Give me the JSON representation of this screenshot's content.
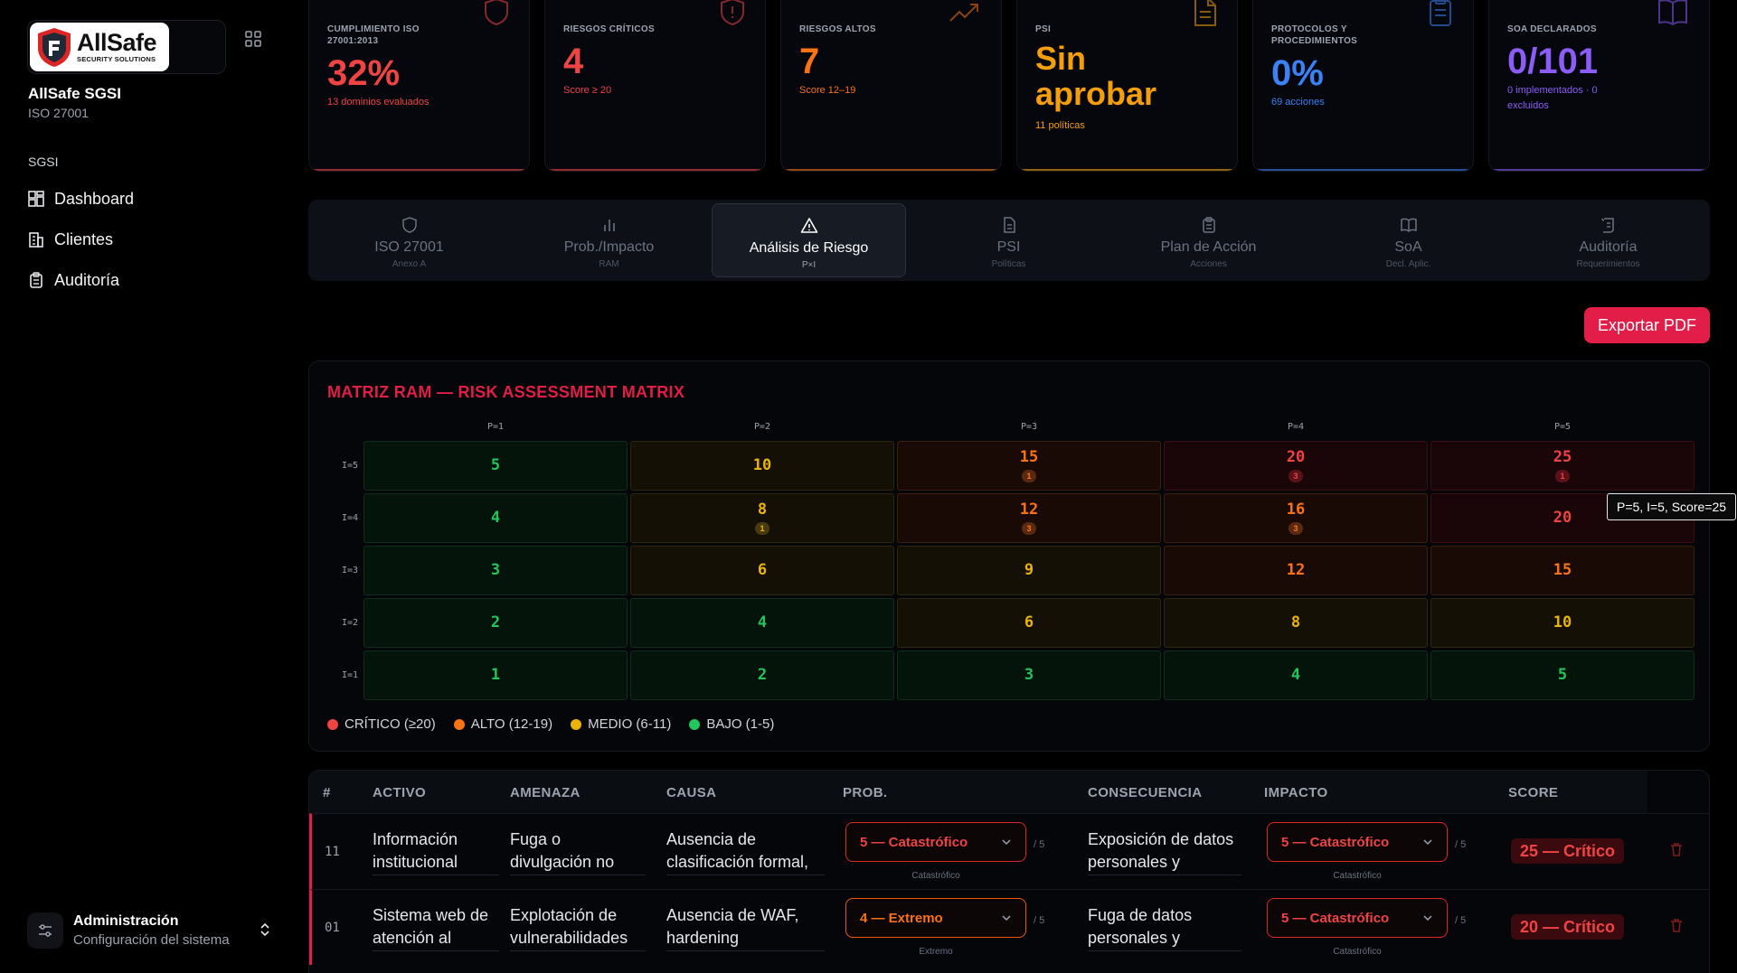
{
  "sidebar": {
    "logo": {
      "brand": "AllSafe",
      "tagline": "SECURITY SOLUTIONS"
    },
    "app_name": "AllSafe SGSI",
    "app_sub": "ISO 27001",
    "section_label": "SGSI",
    "items": [
      {
        "label": "Dashboard",
        "icon": "dashboard-icon"
      },
      {
        "label": "Clientes",
        "icon": "building-icon"
      },
      {
        "label": "Auditoría",
        "icon": "clipboard-icon"
      }
    ],
    "admin": {
      "title": "Administración",
      "subtitle": "Configuración del sistema"
    }
  },
  "kpis": [
    {
      "label": "CUMPLIMIENTO ISO 27001:2013",
      "value": "32%",
      "sub": "13 dominios evaluados",
      "color": "#ef4444",
      "icon": "shield-icon"
    },
    {
      "label": "RIESGOS CRÍTICOS",
      "value": "4",
      "sub": "Score ≥ 20",
      "color": "#ef4444",
      "icon": "shield-alert-icon"
    },
    {
      "label": "RIESGOS ALTOS",
      "value": "7",
      "sub": "Score 12–19",
      "color": "#f97316",
      "icon": "trending-up-icon"
    },
    {
      "label": "PSI",
      "value_line1": "Sin",
      "value_line2": "aprobar",
      "sub": "11 políticas",
      "color": "#f59e0b",
      "icon": "document-icon"
    },
    {
      "label": "PROTOCOLOS Y PROCEDIMIENTOS",
      "value": "0%",
      "sub": "69 acciones",
      "color": "#3b82f6",
      "icon": "clipboard-list-icon"
    },
    {
      "label": "SOA DECLARADOS",
      "value": "0/101",
      "sub_line1": "0 implementados · 0",
      "sub_line2": "excluidos",
      "color": "#8b5cf6",
      "icon": "book-icon"
    }
  ],
  "tabs": [
    {
      "label": "ISO 27001",
      "sub": "Anexo A",
      "icon": "shield-icon"
    },
    {
      "label": "Prob./Impacto",
      "sub": "RAM",
      "icon": "bar-chart-icon"
    },
    {
      "label": "Análisis de Riesgo",
      "sub": "P×I",
      "icon": "warning-triangle-icon",
      "active": true
    },
    {
      "label": "PSI",
      "sub": "Políticas",
      "icon": "document-icon"
    },
    {
      "label": "Plan de Acción",
      "sub": "Acciones",
      "icon": "clipboard-icon"
    },
    {
      "label": "SoA",
      "sub": "Decl. Aplic.",
      "icon": "book-open-icon"
    },
    {
      "label": "Auditoría",
      "sub": "Requerimientos",
      "icon": "scroll-icon"
    }
  ],
  "export_label": "Exportar PDF",
  "matrix": {
    "title": "MATRIZ RAM — RISK ASSESSMENT MATRIX",
    "col_labels": [
      "P=1",
      "P=2",
      "P=3",
      "P=4",
      "P=5"
    ],
    "rows": [
      {
        "label": "I=5",
        "cells": [
          {
            "score": "5"
          },
          {
            "score": "10"
          },
          {
            "score": "15",
            "count": "1"
          },
          {
            "score": "20",
            "count": "3"
          },
          {
            "score": "25",
            "count": "1"
          }
        ]
      },
      {
        "label": "I=4",
        "cells": [
          {
            "score": "4"
          },
          {
            "score": "8",
            "count": "1"
          },
          {
            "score": "12",
            "count": "3"
          },
          {
            "score": "16",
            "count": "3"
          },
          {
            "score": "20"
          }
        ]
      },
      {
        "label": "I=3",
        "cells": [
          {
            "score": "3"
          },
          {
            "score": "6"
          },
          {
            "score": "9"
          },
          {
            "score": "12"
          },
          {
            "score": "15"
          }
        ]
      },
      {
        "label": "I=2",
        "cells": [
          {
            "score": "2"
          },
          {
            "score": "4"
          },
          {
            "score": "6"
          },
          {
            "score": "8"
          },
          {
            "score": "10"
          }
        ]
      },
      {
        "label": "I=1",
        "cells": [
          {
            "score": "1"
          },
          {
            "score": "2"
          },
          {
            "score": "3"
          },
          {
            "score": "4"
          },
          {
            "score": "5"
          }
        ]
      }
    ],
    "legend": [
      {
        "label": "CRÍTICO (≥20)",
        "color": "#ef4444"
      },
      {
        "label": "ALTO (12-19)",
        "color": "#f97316"
      },
      {
        "label": "MEDIO (6-11)",
        "color": "#eab308"
      },
      {
        "label": "BAJO (1-5)",
        "color": "#22c55e"
      }
    ],
    "tooltip": "P=5, I=5, Score=25",
    "level_colors": {
      "critico": {
        "text": "#ef4444",
        "bg": "#1a0508",
        "border": "#3a0f14"
      },
      "alto": {
        "text": "#f97316",
        "bg": "#1a0a05",
        "border": "#3a1f10"
      },
      "medio": {
        "text": "#eab308",
        "bg": "#141005",
        "border": "#2f2610"
      },
      "bajo": {
        "text": "#22c55e",
        "bg": "#04140b",
        "border": "#0f2e1b"
      }
    }
  },
  "risk_table": {
    "headers": [
      "#",
      "ACTIVO",
      "AMENAZA",
      "CAUSA",
      "PROB.",
      "CONSECUENCIA",
      "IMPACTO",
      "SCORE"
    ],
    "rows": [
      {
        "num": "11",
        "activo": "Información institucional",
        "amenaza": "Fuga o divulgación no",
        "causa": "Ausencia de clasificación formal,",
        "prob": "5 — Catastrófico",
        "prob_hint": "Catastrófico",
        "consecuencia": "Exposición de datos personales y",
        "impacto": "5 — Catastrófico",
        "impacto_hint": "Catastrófico",
        "max": "/ 5",
        "score": "25 — Crítico"
      },
      {
        "num": "01",
        "activo": "Sistema web de atención al",
        "amenaza": "Explotación de vulnerabilidades",
        "causa": "Ausencia de WAF, hardening",
        "prob": "4 — Extremo",
        "prob_hint": "Extremo",
        "consecuencia": "Fuga de datos personales y",
        "impacto": "5 — Catastrófico",
        "impacto_hint": "Catastrófico",
        "max": "/ 5",
        "score": "20 — Crítico"
      }
    ]
  }
}
